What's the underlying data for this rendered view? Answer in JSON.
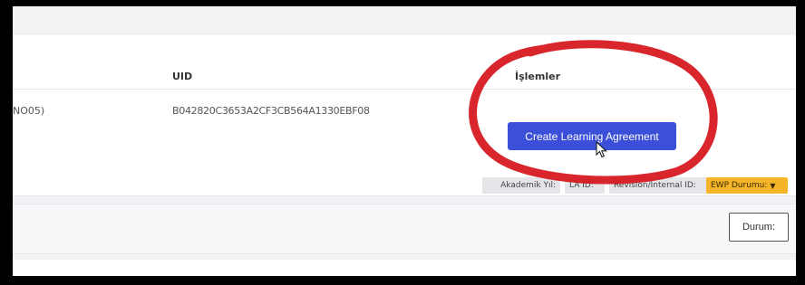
{
  "table": {
    "headers": {
      "uid": "UID",
      "operations": "İşlemler"
    },
    "row": {
      "name_fragment": "NO05)",
      "uid": "B042820C3653A2CF3CB564A1330EBF08"
    }
  },
  "actions": {
    "create_learning_agreement": "Create Learning Agreement"
  },
  "info_chips": {
    "academic_year": "Akademik Yıl:",
    "la_id": "LA ID:",
    "revision": "Revision/Internal ID:",
    "ewp_status": "EWP Durumu:"
  },
  "filters": {
    "status_button": "Durum:"
  },
  "colors": {
    "primary_button": "#3b4fd8",
    "ewp_badge": "#f5b528",
    "annotation_circle": "#d6141a"
  }
}
